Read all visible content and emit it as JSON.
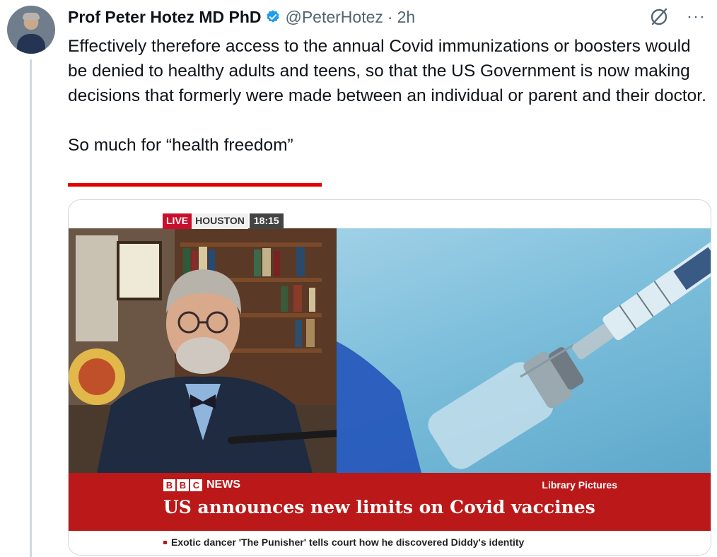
{
  "tweet": {
    "author_name": "Prof Peter Hotez MD PhD",
    "handle": "@PeterHotez",
    "separator": "·",
    "time": "2h",
    "paragraph_1": "Effectively therefore access to the annual Covid immunizations or boosters would be denied to healthy adults and teens, so that the US Government is now making decisions that formerly were made between an individual or parent and their doctor.",
    "paragraph_2": "So much for “health freedom”",
    "more_label": "···"
  },
  "media": {
    "live_label": "LIVE",
    "location": "HOUSTON",
    "clock": "18:15",
    "bbc_letters": [
      "B",
      "B",
      "C"
    ],
    "news_label": "NEWS",
    "library_label": "Library Pictures",
    "headline": "US announces new limits on Covid vaccines",
    "ticker": "Exotic dancer 'The Punisher' tells court how he discovered Diddy's identity"
  },
  "colors": {
    "verified": "#1d9bf0",
    "underline": "#e50000",
    "bbc_red": "#bb1919"
  },
  "icons": [
    "verified-badge-icon",
    "grok-icon",
    "more-options-icon"
  ]
}
